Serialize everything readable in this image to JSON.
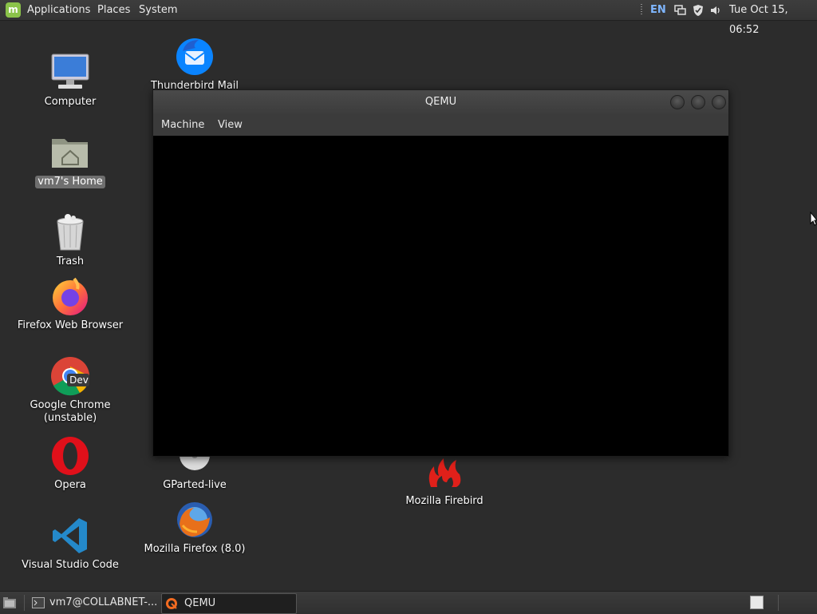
{
  "top_panel": {
    "applications": "Applications",
    "places": "Places",
    "system": "System",
    "lang": "EN",
    "clock": "Tue Oct 15, 06:52"
  },
  "desktop": {
    "computer": "Computer",
    "home": "vm7's Home",
    "trash": "Trash",
    "firefox": "Firefox Web Browser",
    "chrome_line1": "Google Chrome",
    "chrome_line2": "(unstable)",
    "chrome_badge": "Dev",
    "opera": "Opera",
    "vscode": "Visual Studio Code",
    "thunderbird": "Thunderbird Mail",
    "gparted": "GParted-live",
    "firefox8": "Mozilla Firefox (8.0)",
    "firebird": "Mozilla Firebird"
  },
  "window": {
    "title": "QEMU",
    "menu_machine": "Machine",
    "menu_view": "View"
  },
  "taskbar": {
    "terminal": "vm7@COLLABNET-...",
    "qemu": "QEMU"
  }
}
